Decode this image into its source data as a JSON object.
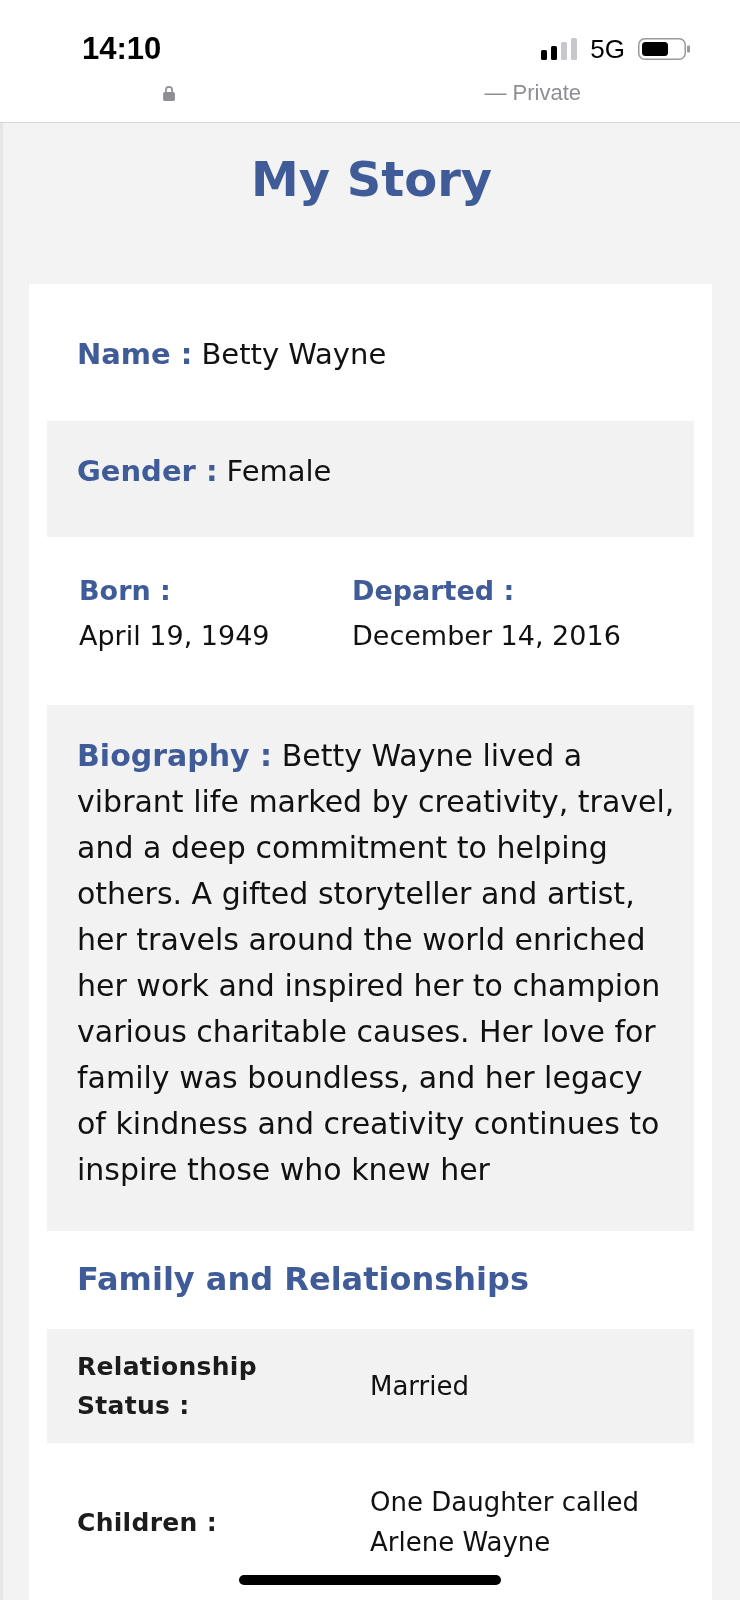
{
  "status_bar": {
    "time": "14:10",
    "network": "5G"
  },
  "browser_bar": {
    "label": "— Private"
  },
  "page": {
    "title": "My Story"
  },
  "profile": {
    "fields": [
      {
        "label": "Name :",
        "value": "Betty Wayne"
      },
      {
        "label": "Gender :",
        "value": "Female"
      }
    ],
    "dates": [
      {
        "label": "Born :",
        "value": "April 19, 1949"
      },
      {
        "label": "Departed :",
        "value": "December 14, 2016"
      }
    ],
    "biography": "**Biography :** Betty Wayne lived a vibrant life marked by creativity, travel, and a deep commitment to helping others. A gifted storyteller and artist, her travels around the world enriched her work and inspired her to champion various charitable causes. Her love for family was boundless, and her legacy of kindness and creativity continues to inspire those who knew her"
  },
  "family": {
    "heading": "Family and Relationships",
    "rows": [
      {
        "label": "Relationship Status :",
        "value": "Married"
      },
      {
        "label": "Children :",
        "value": "One Daughter called Arlene Wayne"
      }
    ]
  }
}
